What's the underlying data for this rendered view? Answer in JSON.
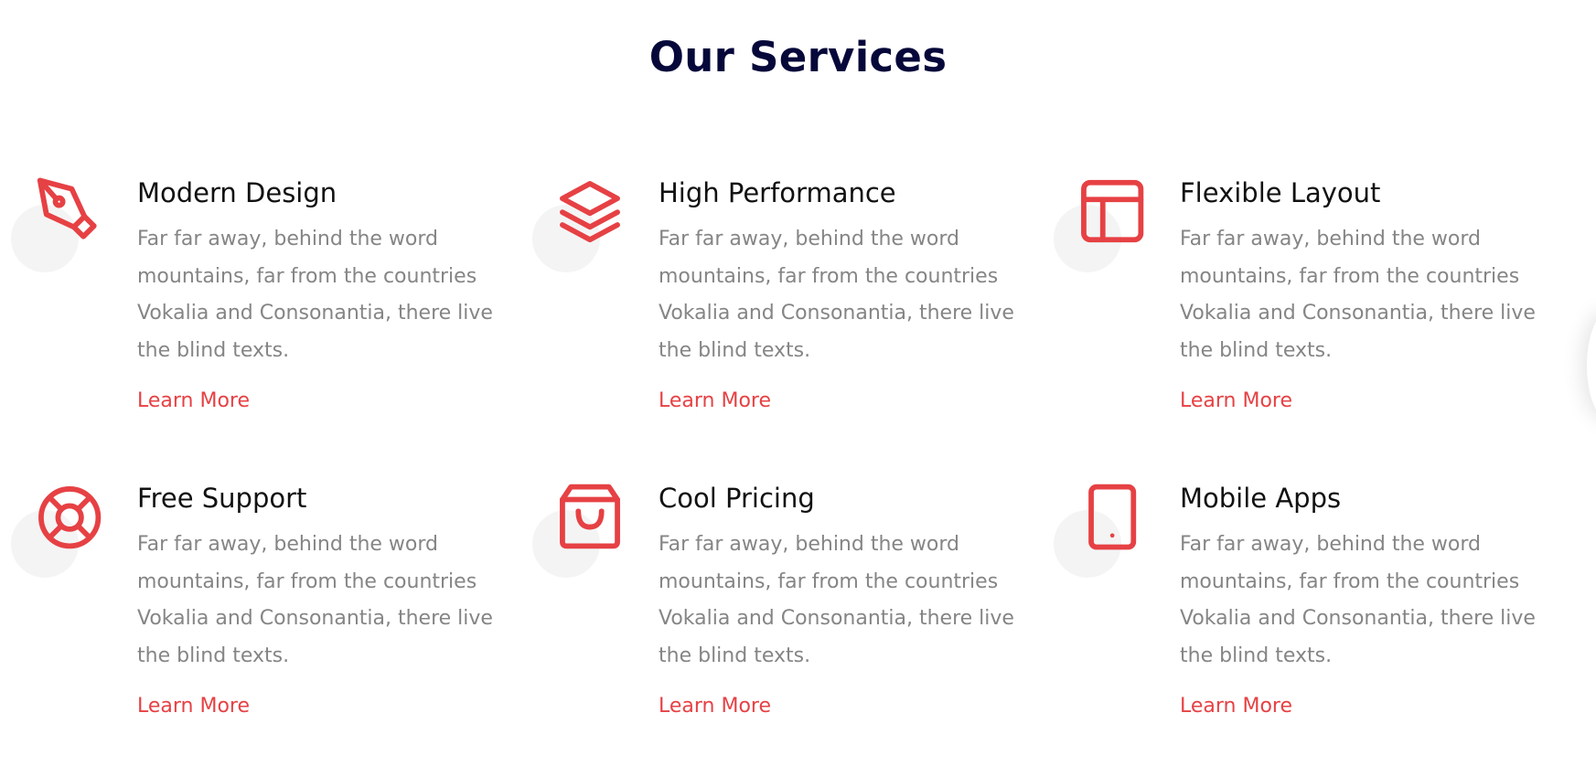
{
  "section": {
    "title": "Our Services"
  },
  "colors": {
    "accent": "#e64144",
    "heading": "#06083a",
    "body_text": "#858585",
    "icon_backdrop": "#f4f4f4"
  },
  "services": [
    {
      "icon": "pen-nib-icon",
      "title": "Modern Design",
      "description": "Far far away, behind the word mountains, far from the countries Vokalia and Consonantia, there live the blind texts.",
      "link": "Learn More"
    },
    {
      "icon": "layers-icon",
      "title": "High Performance",
      "description": "Far far away, behind the word mountains, far from the countries Vokalia and Consonantia, there live the blind texts.",
      "link": "Learn More"
    },
    {
      "icon": "layout-icon",
      "title": "Flexible Layout",
      "description": "Far far away, behind the word mountains, far from the countries Vokalia and Consonantia, there live the blind texts.",
      "link": "Learn More"
    },
    {
      "icon": "lifebuoy-icon",
      "title": "Free Support",
      "description": "Far far away, behind the word mountains, far from the countries Vokalia and Consonantia, there live the blind texts.",
      "link": "Learn More"
    },
    {
      "icon": "shopping-bag-icon",
      "title": "Cool Pricing",
      "description": "Far far away, behind the word mountains, far from the countries Vokalia and Consonantia, there live the blind texts.",
      "link": "Learn More"
    },
    {
      "icon": "tablet-icon",
      "title": "Mobile Apps",
      "description": "Far far away, behind the word mountains, far from the countries Vokalia and Consonantia, there live the blind texts.",
      "link": "Learn More"
    }
  ]
}
